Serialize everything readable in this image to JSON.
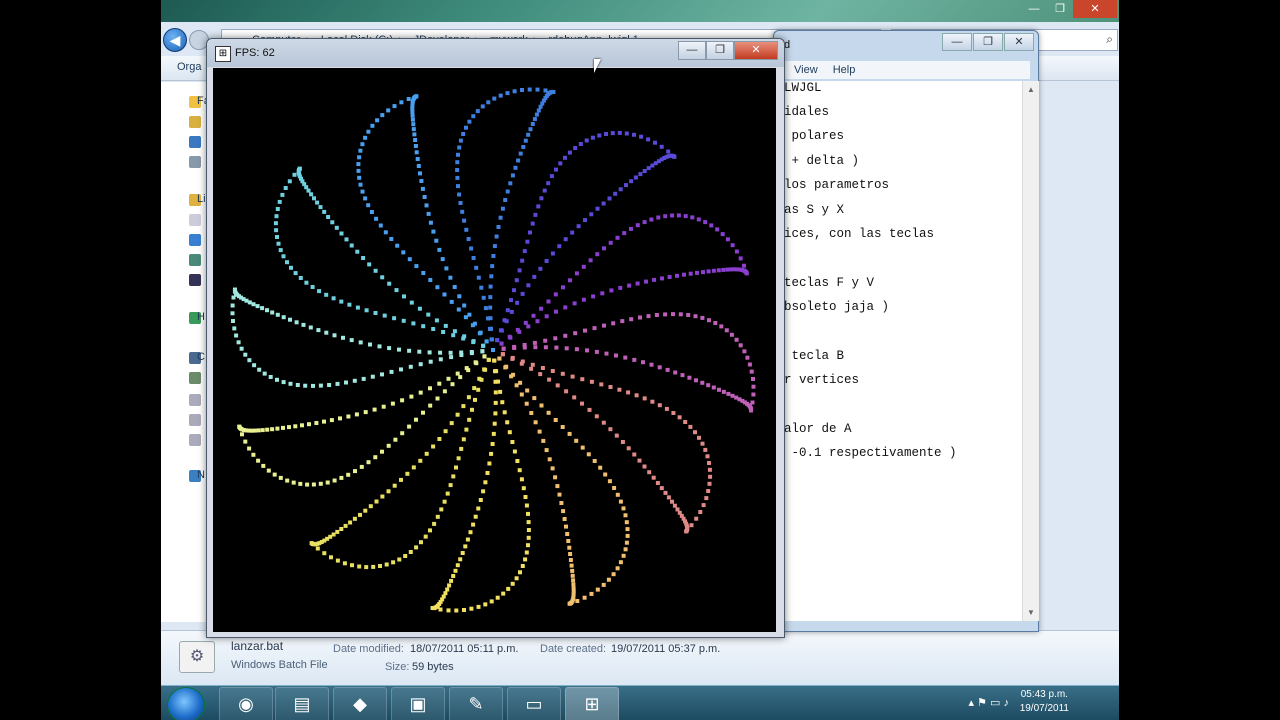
{
  "explorer": {
    "breadcrumb": [
      "Computer",
      "Local Disk (C:)",
      "JDeveloper",
      "mywork",
      "rdebugApp_lwjgl 1"
    ],
    "toolbar_organize": "Orga",
    "nav_truncated": [
      "Fa",
      "Li",
      "H",
      "C",
      "N"
    ],
    "details": {
      "file_name": "lanzar.bat",
      "file_type": "Windows Batch File",
      "modified_label": "Date modified:",
      "modified_value": "18/07/2011 05:11 p.m.",
      "created_label": "Date created:",
      "created_value": "19/07/2011 05:37 p.m.",
      "size_label": "Size:",
      "size_value": "59 bytes"
    }
  },
  "notepad": {
    "title_fragment": "d",
    "menu": [
      "View",
      "Help"
    ],
    "lines": [
      "LWJGL",
      "idales",
      " polares",
      " + delta )",
      "los parametros",
      "as S y X",
      "ices, con las teclas",
      "",
      "teclas F y V",
      "bsoleto jaja )",
      "",
      " tecla B",
      "r vertices",
      "",
      "alor de A",
      " -0.1 respectivamente )"
    ]
  },
  "lwjgl": {
    "caption": "FPS: 62",
    "petals": 12,
    "colors": [
      "#3f7fe0",
      "#5a4ad8",
      "#8a3fd0",
      "#c060b8",
      "#e08a88",
      "#f0c070",
      "#f2e060",
      "#e8e060",
      "#e8f090",
      "#a0e8e0",
      "#6fd0e0",
      "#4aa0f0"
    ]
  },
  "taskbar": {
    "time": "05:43 p.m.",
    "date": "19/07/2011"
  }
}
